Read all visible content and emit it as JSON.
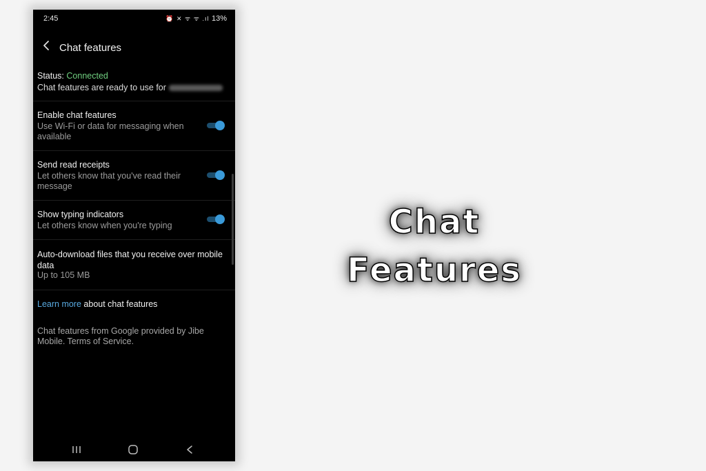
{
  "statusbar": {
    "time": "2:45",
    "icons": "⏰ ✕ ᯤ ᯤ .ıl",
    "battery": "13%"
  },
  "appbar": {
    "title": "Chat features",
    "back_icon": "chevron-left-icon"
  },
  "status": {
    "label": "Status: ",
    "value": "Connected",
    "description": "Chat features are ready to use for"
  },
  "settings": [
    {
      "title": "Enable chat features",
      "description": "Use Wi-Fi or data for messaging when available",
      "enabled": true
    },
    {
      "title": "Send read receipts",
      "description": "Let others know that you've read their message",
      "enabled": true
    },
    {
      "title": "Show typing indicators",
      "description": "Let others know when you're typing",
      "enabled": true
    }
  ],
  "auto_download": {
    "title": "Auto-download files that you receive over mobile data",
    "value": "Up to 105 MB"
  },
  "learn_more": {
    "link_text": "Learn more",
    "rest": " about chat features"
  },
  "footer": {
    "text": "Chat features from Google provided by Jibe Mobile. Terms of Service."
  },
  "navbar": {
    "recent_icon": "recent-apps-icon",
    "home_icon": "home-icon",
    "back_icon": "back-icon"
  },
  "overlay": {
    "title": "Chat Features"
  },
  "colors": {
    "accent": "#3a9ad9",
    "connected": "#6fce7f",
    "link": "#58a9e0"
  }
}
